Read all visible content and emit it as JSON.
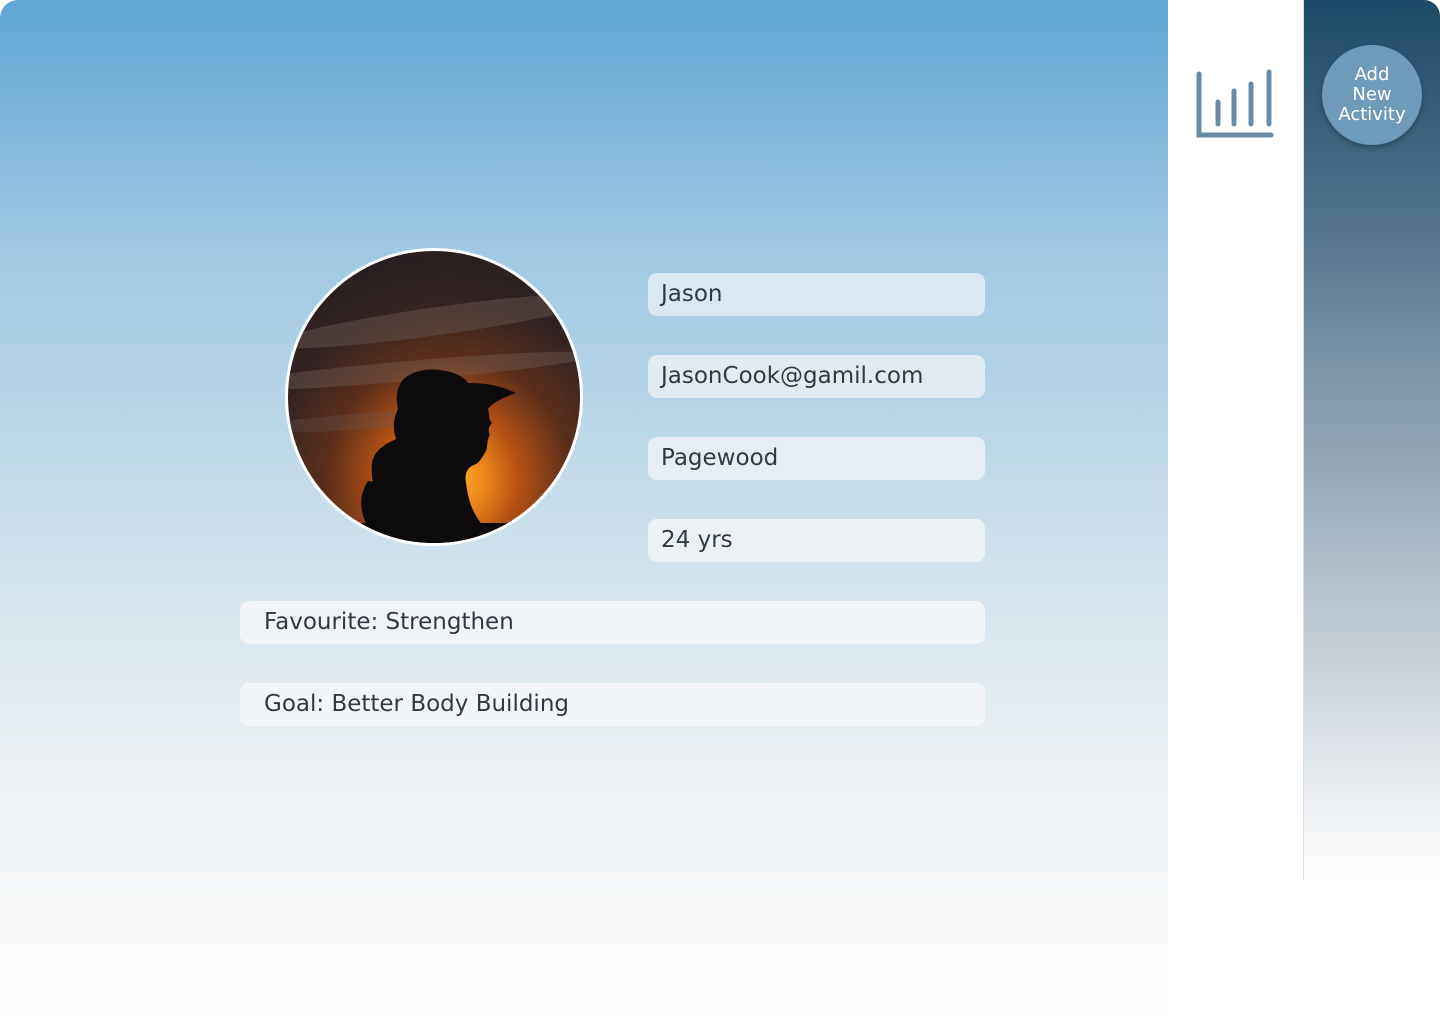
{
  "profile": {
    "avatar_alt": "silhouette at sunset",
    "name": "Jason",
    "email": "JasonCook@gamil.com",
    "location": "Pagewood",
    "age": "24 yrs",
    "favourite": "Favourite: Strengthen",
    "goal": "Goal: Better Body Building"
  },
  "nav": {
    "stats_icon": "bar-chart-icon",
    "add_activity": {
      "line1": "Add",
      "line2": "New",
      "line3": "Activity"
    }
  },
  "colors": {
    "main_gradient_top": "#5ea7d5",
    "rail_gradient_top": "#1d4a66",
    "add_button": "#6e9bb9",
    "stats_icon": "#6b8ba3",
    "text": "#2f3a44"
  }
}
